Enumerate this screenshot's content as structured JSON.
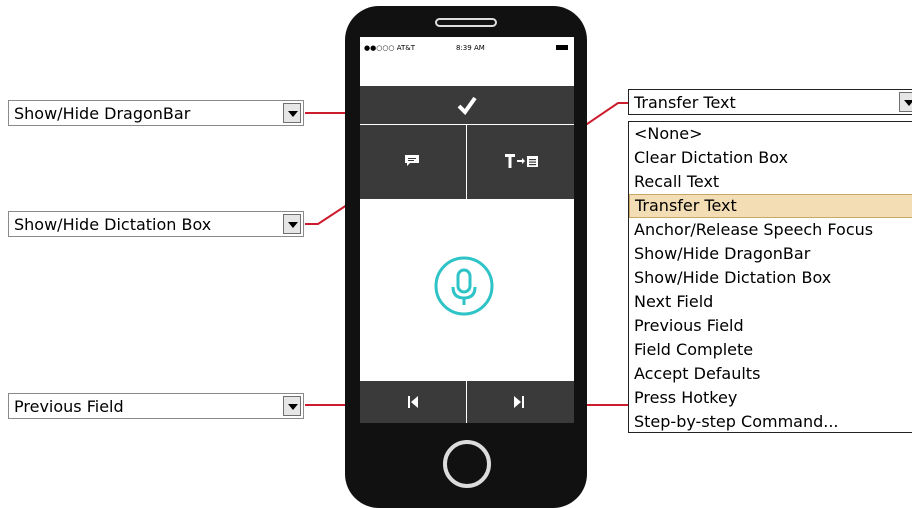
{
  "dropdowns": {
    "dragonbar": {
      "value": "Show/Hide DragonBar"
    },
    "dictation": {
      "value": "Show/Hide Dictation Box"
    },
    "previous": {
      "value": "Previous Field"
    },
    "transfer": {
      "value": "Transfer Text"
    }
  },
  "options": [
    "<None>",
    "Clear Dictation Box",
    "Recall Text",
    "Transfer Text",
    "Anchor/Release Speech Focus",
    "Show/Hide DragonBar",
    "Show/Hide Dictation Box",
    "Next Field",
    "Previous Field",
    "Field Complete",
    "Accept Defaults",
    "Press Hotkey",
    "Step-by-step Command..."
  ],
  "selected_option": "Transfer Text",
  "phone": {
    "carrier": "●●○○○ AT&T",
    "time": "8:39 AM",
    "icons": {
      "check": "checkmark-icon",
      "chat": "chat-bubble-icon",
      "transfer": "transfer-text-icon",
      "mic": "microphone-icon",
      "prev": "previous-field-icon",
      "next": "next-field-icon"
    }
  },
  "colors": {
    "connector": "#cc1d2e",
    "mic": "#2ec4c7",
    "selection": "#f3ddb4"
  }
}
